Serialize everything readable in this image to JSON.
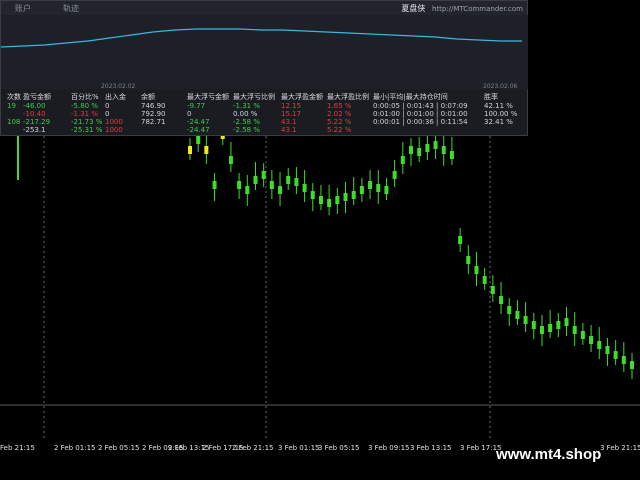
{
  "panel": {
    "brand_title": "夏盘侠",
    "brand_url": "http://MTCommander.com",
    "header_tabs": [
      "",
      "账户",
      "",
      "轨迹"
    ],
    "date_start": "2023.02.02",
    "date_end": "2023.02.06",
    "equity_curve": [
      88,
      87,
      86,
      84,
      82,
      79,
      76,
      73,
      71,
      70,
      70,
      70,
      71,
      71,
      72,
      73,
      74,
      75,
      76,
      77,
      78,
      80,
      81,
      82,
      82
    ]
  },
  "stats": {
    "columns": [
      {
        "header": "次数",
        "values": [
          "19",
          "",
          "108",
          ""
        ],
        "colors": [
          "green",
          "red",
          "green",
          "neutral"
        ]
      },
      {
        "header": "盈亏金额",
        "values": [
          "-46.00",
          "-10.40",
          "-217.29",
          "-253.1"
        ],
        "colors": [
          "green",
          "red",
          "green",
          "neutral"
        ]
      },
      {
        "header": "百分比%",
        "values": [
          "-5.80 %",
          "-1.31 %",
          "-21.73 %",
          "-25.31 %"
        ],
        "colors": [
          "green",
          "red",
          "green",
          "green"
        ]
      },
      {
        "header": "出入金",
        "values": [
          "0",
          "0",
          "1000",
          "1000"
        ],
        "colors": [
          "neutral",
          "neutral",
          "red",
          "red"
        ]
      },
      {
        "header": "余额",
        "values": [
          "746.90",
          "792.90",
          "782.71",
          ""
        ],
        "colors": [
          "neutral",
          "neutral",
          "neutral",
          "neutral"
        ]
      },
      {
        "header": "最大浮亏金额",
        "values": [
          "-9.77",
          "0",
          "-24.47",
          "-24.47"
        ],
        "colors": [
          "green",
          "neutral",
          "green",
          "green"
        ]
      },
      {
        "header": "最大浮亏比例",
        "values": [
          "-1.31 %",
          "0.00 %",
          "-2.58 %",
          "-2.58 %"
        ],
        "colors": [
          "green",
          "neutral",
          "green",
          "green"
        ]
      },
      {
        "header": "最大浮盈金额",
        "values": [
          "12.15",
          "15.17",
          "43.1",
          "43.1"
        ],
        "colors": [
          "red",
          "red",
          "red",
          "red"
        ]
      },
      {
        "header": "最大浮盈比例",
        "values": [
          "1.65 %",
          "2.02 %",
          "5.22 %",
          "5.22 %"
        ],
        "colors": [
          "red",
          "red",
          "red",
          "red"
        ]
      },
      {
        "header": "最小|平均|最大持仓时间",
        "values": [
          "0:00:05 | 0:01:43 | 0:07:09",
          "0:01:00 | 0:01:00 | 0:01:00",
          "0:00:01 | 0:00:36 | 0:11:54",
          ""
        ],
        "colors": [
          "neutral",
          "neutral",
          "neutral",
          "neutral"
        ]
      },
      {
        "header": "胜率",
        "values": [
          "42.11 %",
          "100.00 %",
          "32.41 %",
          ""
        ],
        "colors": [
          "neutral",
          "neutral",
          "neutral",
          "neutral"
        ]
      }
    ]
  },
  "time_axis": [
    "Feb 21:15",
    "2 Feb 01:15",
    "2 Feb 05:15",
    "2 Feb 09:15",
    "2 Feb 13:15",
    "2 Feb 17:15",
    "2 Feb 21:15",
    "3 Feb 01:15",
    "3 Feb 05:15",
    "3 Feb 09:15",
    "3 Feb 13:15",
    "3 Feb 17:15",
    "3 Feb 21:15"
  ],
  "price_series": [
    150,
    140,
    150,
    185,
    135,
    160,
    185,
    190,
    180,
    175,
    185,
    190,
    180,
    182,
    188,
    195,
    200,
    203,
    200,
    197,
    195,
    190,
    185,
    188,
    190,
    175,
    160,
    150,
    152,
    148,
    145,
    150,
    155,
    240,
    260,
    270,
    280,
    290,
    300,
    310,
    315,
    320,
    325,
    330,
    328,
    325,
    322,
    330,
    335,
    340,
    345,
    350,
    355,
    360,
    365
  ],
  "watermark": "www.mt4.shop",
  "colors": {
    "candle": "#3fdc2a",
    "candle_alt": "#f2e81a",
    "equity": "#3bb6e0",
    "grid": "#888888",
    "bottom_line": "#777777"
  }
}
